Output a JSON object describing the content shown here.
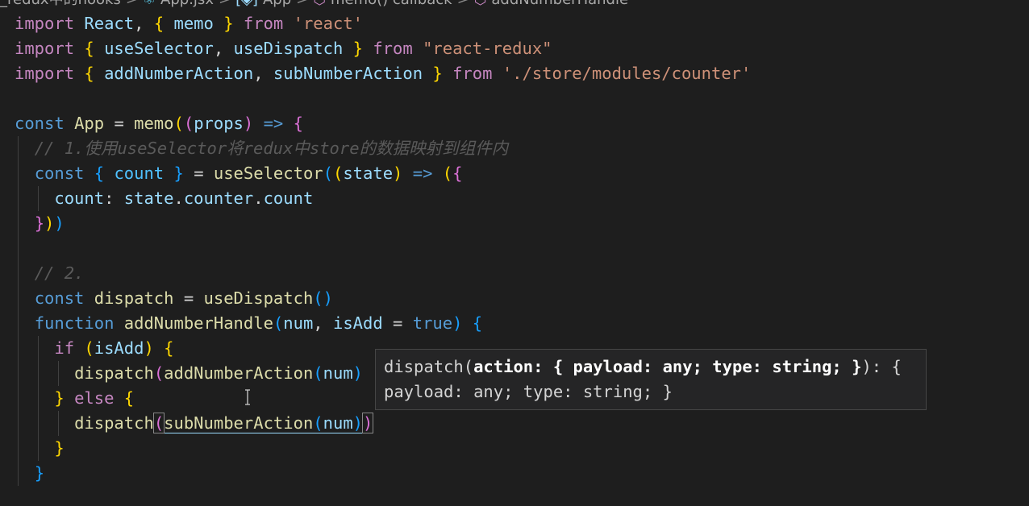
{
  "breadcrumb": {
    "items": [
      {
        "label": "_redux中的hooks",
        "icon": "folder-icon"
      },
      {
        "label": "App.jsx",
        "icon": "react-icon"
      },
      {
        "label": "App",
        "icon": "variable-icon"
      },
      {
        "label": "memo() callback",
        "icon": "function-cube-icon"
      },
      {
        "label": "addNumberHandle",
        "icon": "function-cube-icon"
      }
    ],
    "separator": ">"
  },
  "code": {
    "l1": {
      "kw1": "import",
      "id": "React",
      "comma": ",",
      "ob": "{",
      "mid": "memo",
      "cb": "}",
      "kw2": "from",
      "src": "'react'"
    },
    "l2": {
      "kw1": "import",
      "ob": "{",
      "a": "useSelector",
      "comma": ",",
      "b": "useDispatch",
      "cb": "}",
      "kw2": "from",
      "src": "\"react-redux\""
    },
    "l3": {
      "kw1": "import",
      "ob": "{",
      "a": "addNumberAction",
      "comma": ",",
      "b": "subNumberAction",
      "cb": "}",
      "kw2": "from",
      "src": "'./store/modules/counter'"
    },
    "l5": {
      "c": "const",
      "name": "App",
      "eq": "=",
      "fn": "memo",
      "p1": "(",
      "p2": "(",
      "arg": "props",
      "p3": ")",
      "arrow": "=>",
      "ob": "{"
    },
    "l6": {
      "comment": "// 1.使用useSelector将redux中store的数据映射到组件内"
    },
    "l7": {
      "c": "const",
      "ob": "{",
      "v": "count",
      "cb": "}",
      "eq": "=",
      "fn": "useSelector",
      "p1": "(",
      "p2": "(",
      "arg": "state",
      "p3": ")",
      "arrow": "=>",
      "p4": "(",
      "ob2": "{"
    },
    "l8": {
      "key": "count",
      "colon": ":",
      "obj": "state",
      "dot1": ".",
      "p1": "counter",
      "dot2": ".",
      "p2": "count"
    },
    "l9": {
      "cb": "}",
      "p1": ")",
      "p2": ")"
    },
    "l11": {
      "comment": "// 2."
    },
    "l12": {
      "c": "const",
      "name": "dispatch",
      "eq": "=",
      "fn": "useDispatch",
      "p": "()"
    },
    "l13": {
      "kw": "function",
      "name": "addNumberHandle",
      "p1": "(",
      "a1": "num",
      "comma": ",",
      "a2": "isAdd",
      "eq": "=",
      "val": "true",
      "p2": ")",
      "ob": "{"
    },
    "l14": {
      "kw": "if",
      "p1": "(",
      "v": "isAdd",
      "p2": ")",
      "ob": "{"
    },
    "l15": {
      "fn": "dispatch",
      "p1": "(",
      "fn2": "addNumberAction",
      "p2": "(",
      "arg": "num",
      "p3": ")"
    },
    "l16": {
      "cb": "}",
      "kw": "else",
      "ob": "{"
    },
    "l17": {
      "fn": "dispatch",
      "p1": "(",
      "fn2": "subNumberAction",
      "p2": "(",
      "arg": "num",
      "p3": ")",
      "p4": ")"
    },
    "l18": {
      "cb": "}"
    },
    "l19": {
      "cb": "}"
    }
  },
  "tooltip": {
    "line1_prefix": "dispatch(",
    "line1_bold": "action: { payload: any; type: string; }",
    "line1_suffix": "): {",
    "line2": "payload: any; type: string; }"
  }
}
